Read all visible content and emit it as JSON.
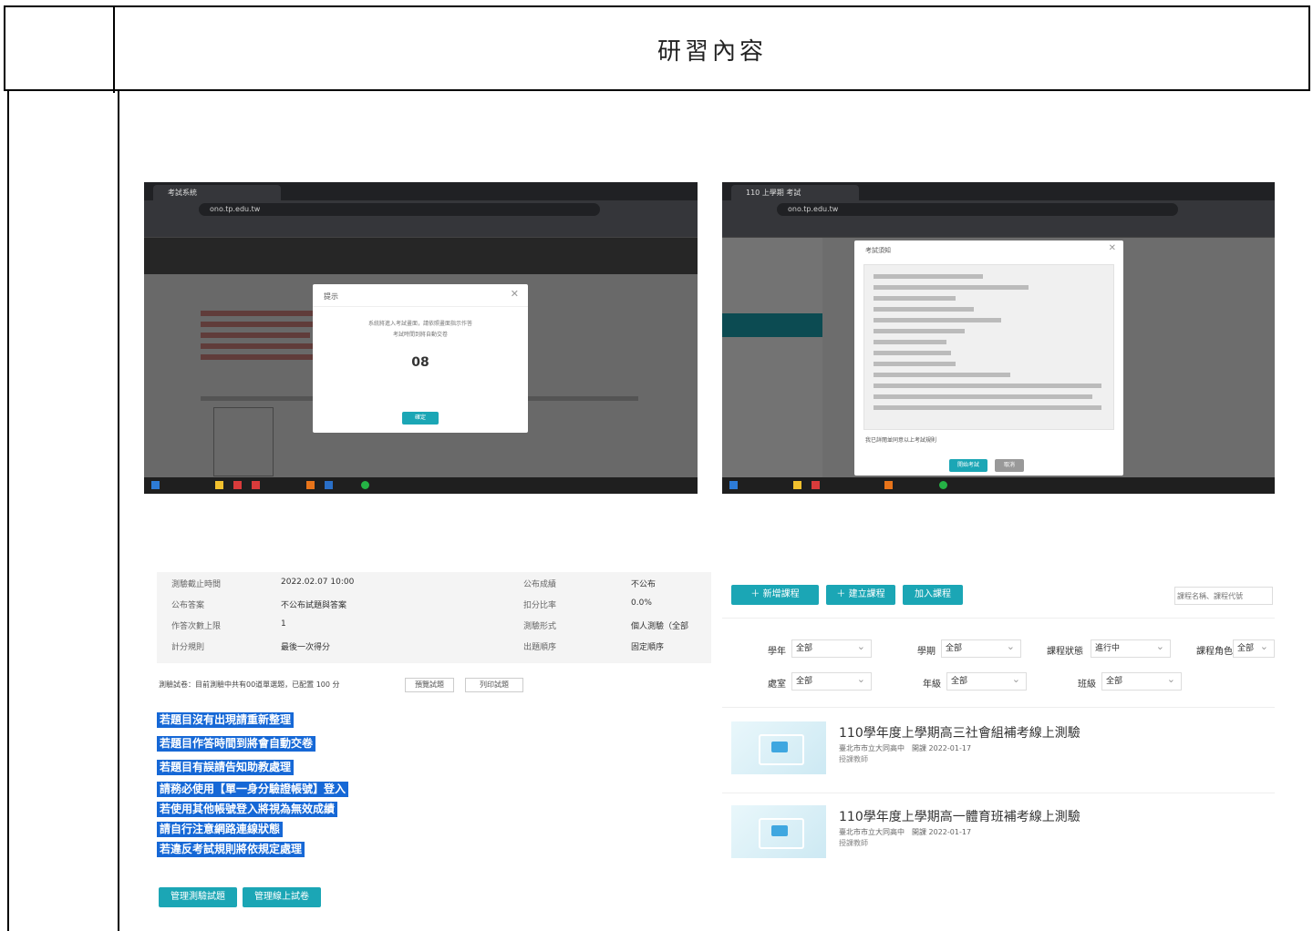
{
  "header": {
    "title": "研習內容"
  },
  "screenshot_1": {
    "tab_title": "考試系統",
    "url": "ono.tp.edu.tw",
    "modal_title": "提示",
    "modal_message": "系統將進入考試畫面，請依照畫面指示作答",
    "modal_sub": "考試時間到將自動交卷",
    "countdown": "08",
    "confirm_label": "確定"
  },
  "screenshot_2": {
    "tab_title": "110 上學期 考試",
    "url": "ono.tp.edu.tw",
    "modal_title": "考試須知",
    "checkbox_label": "我已詳閱並同意以上考試規則",
    "start_label": "開始考試",
    "cancel_label": "取消"
  },
  "panel3": {
    "info_rows": [
      {
        "k1": "測驗截止時間",
        "v1": "2022.02.07 10:00",
        "k2": "公布成績",
        "v2": "不公布"
      },
      {
        "k1": "公布答案",
        "v1": "不公布試題與答案",
        "k2": "扣分比率",
        "v2": "0.0%"
      },
      {
        "k1": "作答次數上限",
        "v1": "1",
        "k2": "測驗形式",
        "v2": "個人測驗（全部"
      },
      {
        "k1": "計分規則",
        "v1": "最後一次得分",
        "k2": "出題順序",
        "v2": "固定順序"
      }
    ],
    "score_text": "測驗試卷：目前測驗中共有00道單選題，已配置 100 分",
    "preview_btn": "預覽試題",
    "print_btn": "列印試題",
    "highlights": [
      "若題目沒有出現請重新整理",
      "若題目作答時間到將會自動交卷",
      "若題目有誤請告知助教處理",
      "請務必使用【單一身分驗證帳號】登入",
      "若使用其他帳號登入將視為無效成績",
      "請自行注意網路連線狀態",
      "若違反考試規則將依規定處理"
    ],
    "btn_a": "管理測驗試題",
    "btn_b": "管理線上試卷"
  },
  "panel4": {
    "btn_add": "＋ 新增課程",
    "btn_create": "＋ 建立課程",
    "btn_join": "加入課程",
    "search_placeholder": "課程名稱、課程代號",
    "filters_row1": [
      {
        "label": "學年",
        "value": "全部"
      },
      {
        "label": "學期",
        "value": "全部"
      },
      {
        "label": "課程狀態",
        "value": "進行中"
      },
      {
        "label": "課程角色",
        "value": "全部"
      }
    ],
    "filters_row2": [
      {
        "label": "處室",
        "value": "全部"
      },
      {
        "label": "年級",
        "value": "全部"
      },
      {
        "label": "班級",
        "value": "全部"
      }
    ],
    "courses": [
      {
        "title": "110學年度上學期高三社會組補考線上測驗",
        "meta": "臺北市市立大同高中　開課 2022-01-17",
        "role": "授課教師"
      },
      {
        "title": "110學年度上學期高一體育班補考線上測驗",
        "meta": "臺北市市立大同高中　開課 2022-01-17",
        "role": "授課教師"
      }
    ]
  }
}
